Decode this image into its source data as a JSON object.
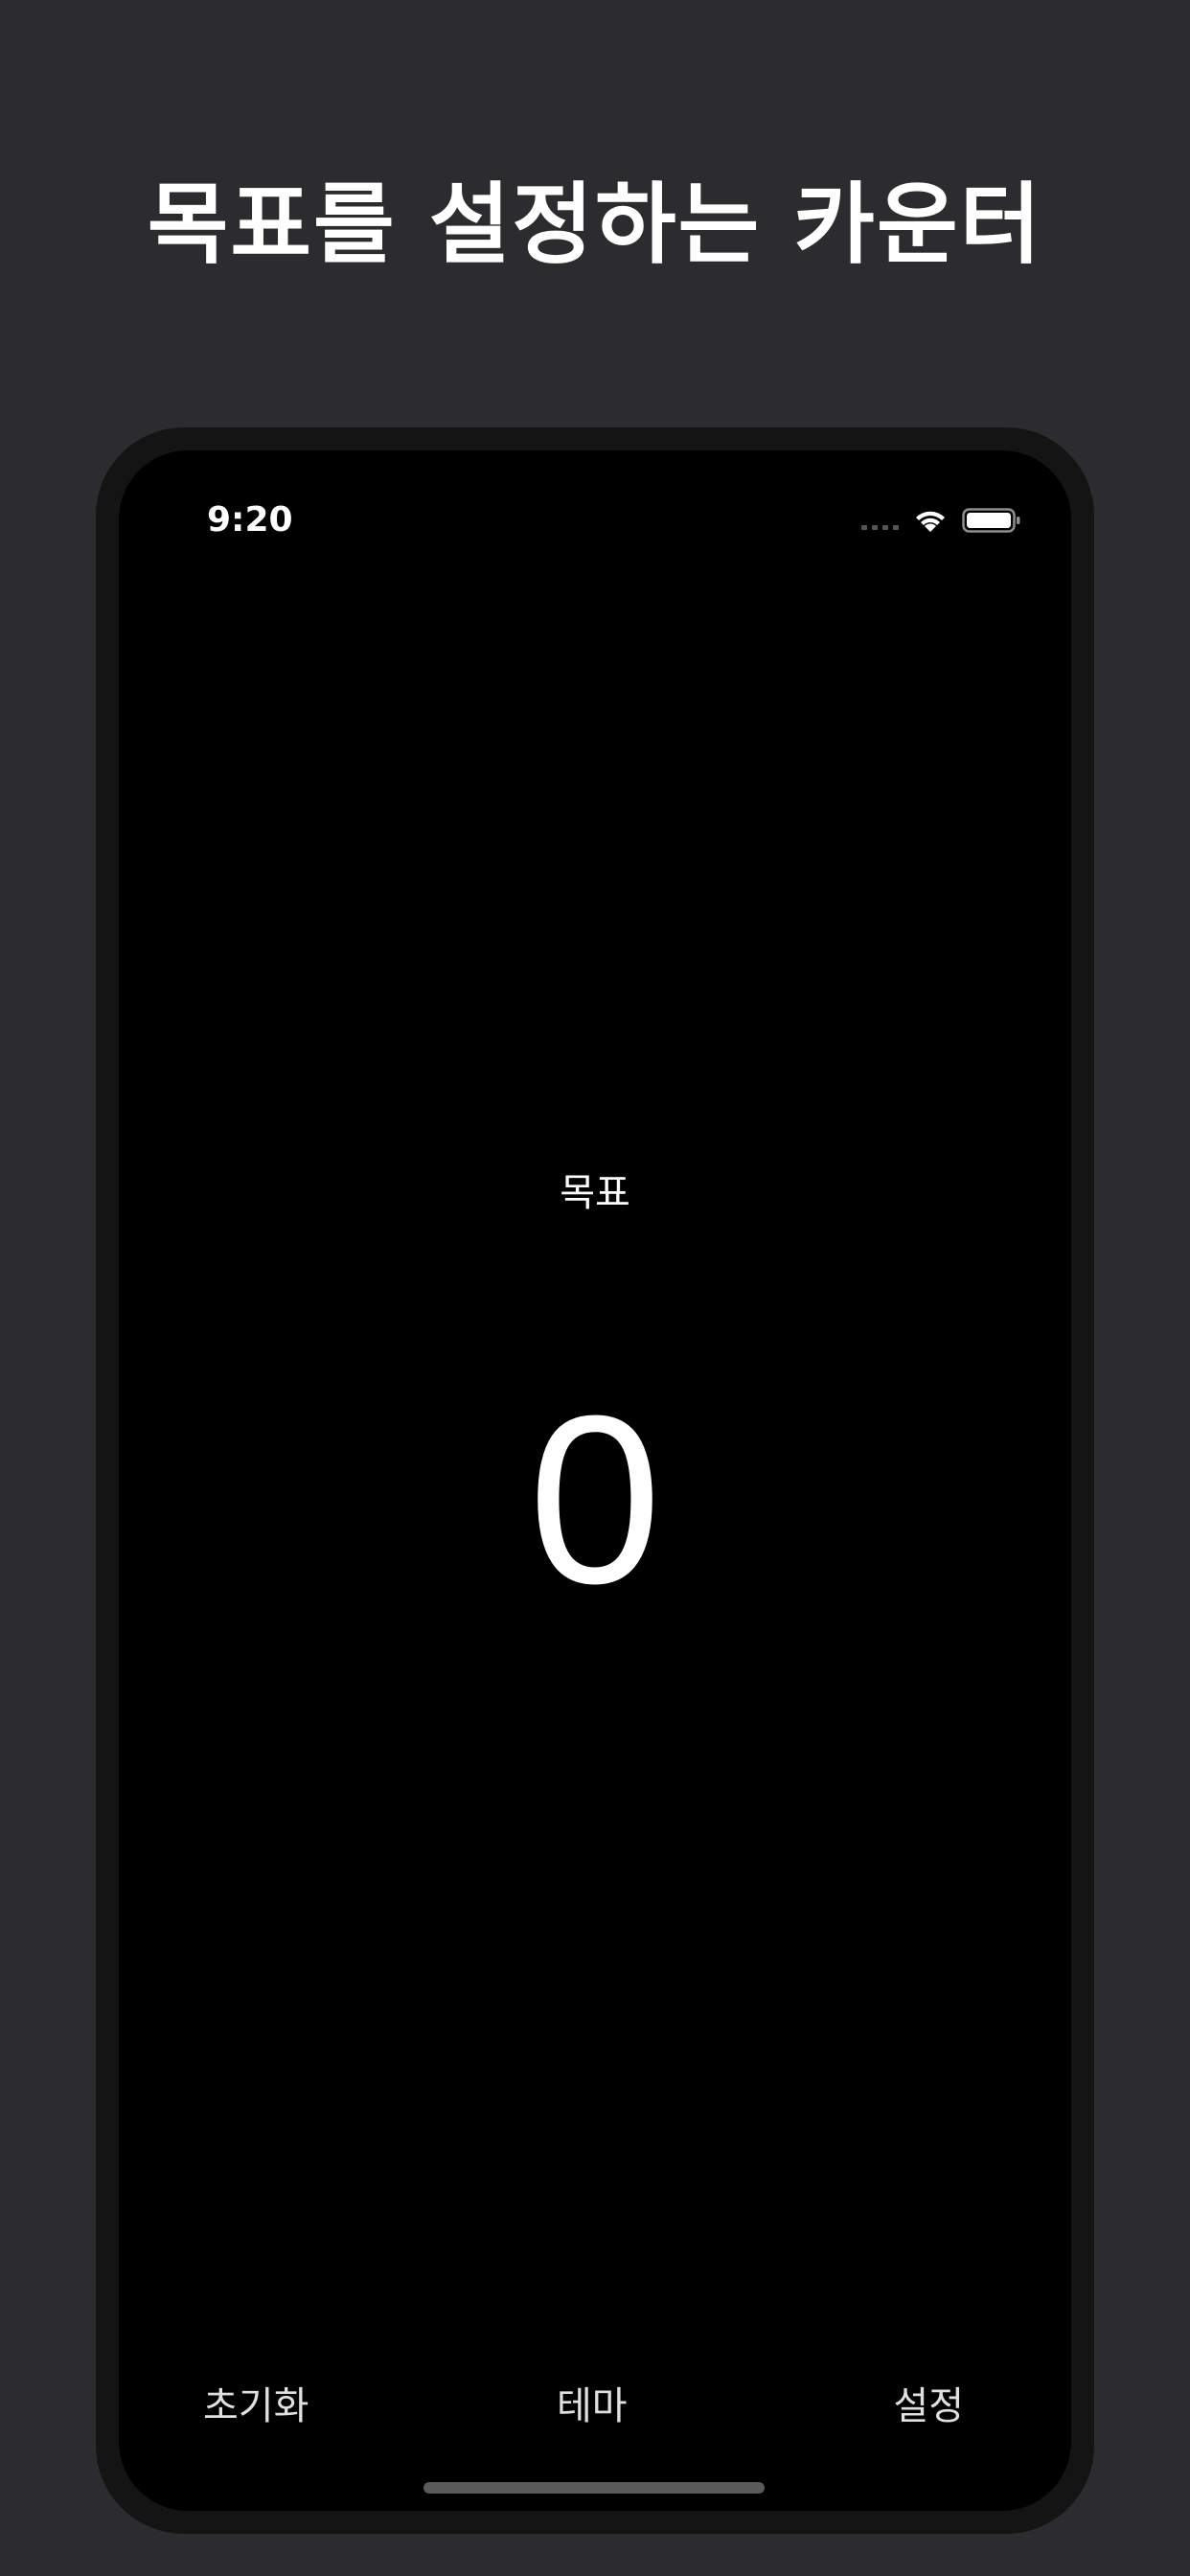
{
  "headline": "목표를 설정하는 카운터",
  "status_bar": {
    "time": "9:20",
    "icons": [
      "cellular-signal-icon",
      "wifi-icon",
      "battery-icon"
    ]
  },
  "main": {
    "goal_label": "목표",
    "counter_value": "0"
  },
  "bottom_bar": {
    "reset_label": "초기화",
    "theme_label": "테마",
    "settings_label": "설정"
  },
  "colors": {
    "page_background": "#2c2c2e",
    "screen_background": "#000000",
    "text": "#ffffff"
  }
}
